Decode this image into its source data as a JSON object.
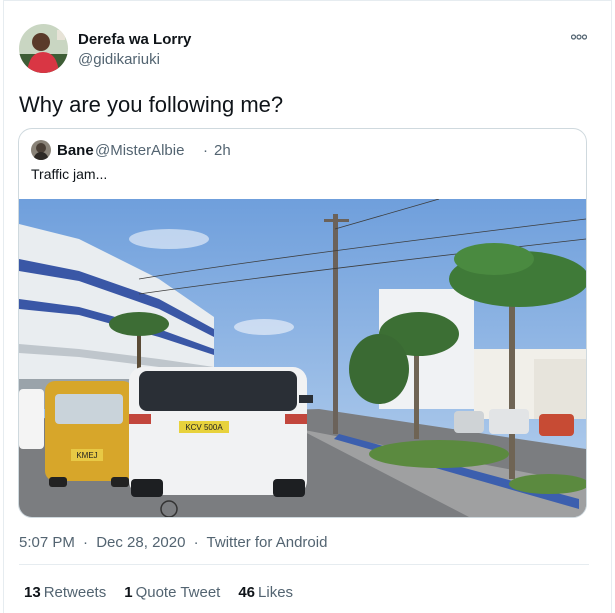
{
  "tweet": {
    "author_name": "Derefa wa Lorry",
    "author_handle": "@gidikariuki",
    "text": "Why are you following me?",
    "time": "5:07 PM",
    "date": "Dec 28, 2020",
    "source": "Twitter for Android",
    "separator": "·"
  },
  "quoted": {
    "author_name": "Bane",
    "author_handle": "@MisterAlbie",
    "separator": "·",
    "time_ago": "2h",
    "text": "Traffic jam..."
  },
  "photo": {
    "plate_car": "KCV 500A",
    "plate_tuk": "KMEJ"
  },
  "stats": [
    {
      "count": "13",
      "label": "Retweets"
    },
    {
      "count": "1",
      "label": "Quote Tweet"
    },
    {
      "count": "46",
      "label": "Likes"
    }
  ],
  "icons": {
    "more": "more-icon"
  }
}
